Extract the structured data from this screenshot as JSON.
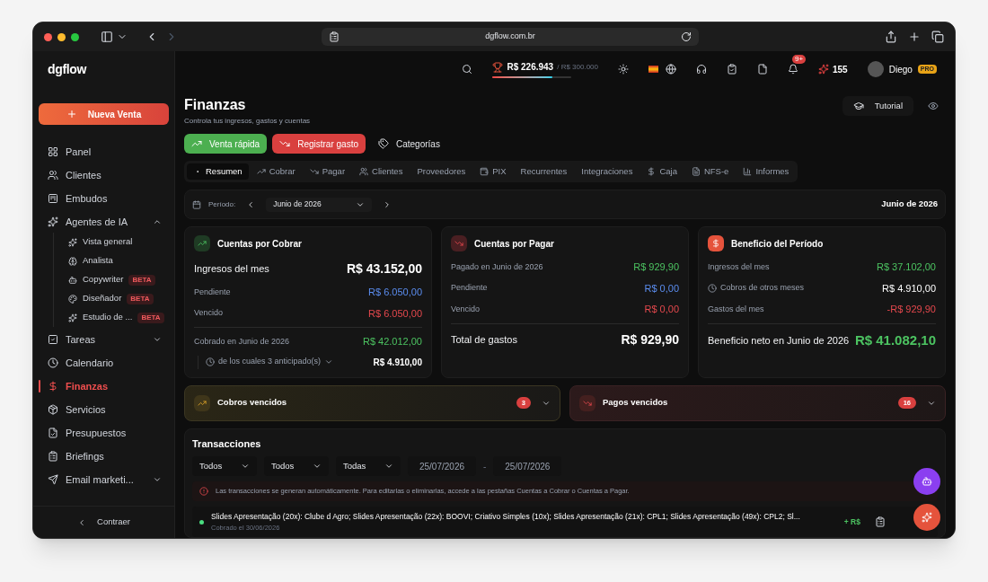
{
  "browser": {
    "url": "dgflow.com.br"
  },
  "header": {
    "logo": "dgflow",
    "balance": "R$ 226.943",
    "goal": "/ R$ 300.000",
    "level": 0.76,
    "notifications": "9+",
    "points": "155",
    "user": "Diego",
    "plan": "PRO"
  },
  "sidebar": {
    "primary_button": "Nueva Venta",
    "items": [
      {
        "label": "Panel",
        "selected": false
      },
      {
        "label": "Clientes",
        "selected": false
      },
      {
        "label": "Embudos",
        "selected": false
      },
      {
        "label": "Agentes de IA",
        "selected": false,
        "expanded": true,
        "children": [
          {
            "label": "Vista general"
          },
          {
            "label": "Analista"
          },
          {
            "label": "Copywriter",
            "badge": "BETA"
          },
          {
            "label": "Diseñador",
            "badge": "BETA"
          },
          {
            "label": "Estudio de ...",
            "badge": "BETA"
          }
        ]
      },
      {
        "label": "Tareas",
        "selected": false,
        "expanded": false
      },
      {
        "label": "Calendario",
        "selected": false
      },
      {
        "label": "Finanzas",
        "selected": true
      },
      {
        "label": "Servicios",
        "selected": false
      },
      {
        "label": "Presupuestos",
        "selected": false
      },
      {
        "label": "Briefings",
        "selected": false
      },
      {
        "label": "Email marketi...",
        "selected": false,
        "expanded": false
      }
    ],
    "collapse": "Contraer"
  },
  "page": {
    "title": "Finanzas",
    "subtitle": "Controla tus ingresos, gastos y cuentas",
    "tutorial": "Tutorial",
    "actions": [
      {
        "label": "Venta rápida",
        "kind": "income"
      },
      {
        "label": "Registrar gasto",
        "kind": "expense"
      },
      {
        "label": "Categorías",
        "kind": "plain"
      }
    ],
    "tabs": [
      {
        "label": "Resumen",
        "selected": true
      },
      {
        "label": "Cobrar",
        "selected": false
      },
      {
        "label": "Pagar",
        "selected": false
      },
      {
        "label": "Clientes",
        "selected": false
      },
      {
        "label": "Proveedores",
        "selected": false
      },
      {
        "label": "PIX",
        "selected": false
      },
      {
        "label": "Recurrentes",
        "selected": false
      },
      {
        "label": "Integraciones",
        "selected": false
      },
      {
        "label": "Caja",
        "selected": false
      },
      {
        "label": "NFS-e",
        "selected": false
      },
      {
        "label": "Informes",
        "selected": false
      }
    ]
  },
  "period": {
    "label": "Período:",
    "value": "Junio de 2026",
    "heading": "Junio de 2026"
  },
  "cards": [
    {
      "title": "Cuentas por Cobrar",
      "kind": "income",
      "rows": [
        {
          "label": "Ingresos del mes",
          "value": "R$ 43.152,00",
          "kind": "main",
          "color": "#ffffff"
        },
        {
          "label": "Pendiente",
          "value": "R$ 6.050,00",
          "kind": "minor",
          "color": "#5b8def"
        },
        {
          "label": "Vencido",
          "value": "R$ 6.050,00",
          "kind": "minor",
          "color": "#e5484d"
        },
        {
          "label": "Cobrado en Junio de 2026",
          "value": "R$ 42.012,00",
          "kind": "divided",
          "color": "#4cc361"
        },
        {
          "label": "de los cuales 3 anticipado(s)",
          "value": "R$ 4.910,00",
          "kind": "sub",
          "color": "#ffffff"
        }
      ]
    },
    {
      "title": "Cuentas por Pagar",
      "kind": "expense",
      "rows": [
        {
          "label": "Pagado en Junio de 2026",
          "value": "R$ 929,90",
          "kind": "minor",
          "color": "#4cc361"
        },
        {
          "label": "Pendiente",
          "value": "R$ 0,00",
          "kind": "minor",
          "color": "#5b8def"
        },
        {
          "label": "Vencido",
          "value": "R$ 0,00",
          "kind": "minor",
          "color": "#e5484d"
        },
        {
          "label": "Total de gastos",
          "value": "R$ 929,90",
          "kind": "total",
          "color": "#ffffff"
        }
      ]
    },
    {
      "title": "Beneficio del Período",
      "kind": "profit",
      "rows": [
        {
          "label": "Ingresos del mes",
          "value": "R$ 37.102,00",
          "kind": "minor",
          "color": "#4cc361"
        },
        {
          "label": "Cobros de otros meses",
          "value": "R$ 4.910,00",
          "kind": "clock",
          "color": "#ffffff"
        },
        {
          "label": "Gastos del mes",
          "value": "-R$ 929,90",
          "kind": "minor",
          "color": "#e5484d"
        },
        {
          "label": "Beneficio neto en Junio de 2026",
          "value": "R$ 41.082,10",
          "kind": "grand",
          "color": "#4cc361"
        }
      ]
    }
  ],
  "overdue": [
    {
      "label": "Cobros vencidos",
      "count": "3",
      "kind": "income"
    },
    {
      "label": "Pagos vencidos",
      "count": "16",
      "kind": "expense"
    }
  ],
  "transactions": {
    "title": "Transacciones",
    "filters": [
      "Todos",
      "Todos",
      "Todas"
    ],
    "date_from": "25/07/2026",
    "date_to": "25/07/2026",
    "date_separator": "-",
    "notice": "Las transacciones se generan automáticamente. Para editarlas o eliminarlas, accede a las pestañas Cuentas a Cobrar o Cuentas a Pagar.",
    "rows": [
      {
        "description": "Slides Apresentação (20x): Clube d Agro; Slides Apresentação (22x): BOOVI; Criativo Simples (10x); Slides Apresentação (21x): CPL1; Slides Apresentação (49x): CPL2; Sl...",
        "date": "Cobrado el 30/06/2026",
        "amount": "+ R$",
        "color": "#4ade80"
      }
    ]
  }
}
